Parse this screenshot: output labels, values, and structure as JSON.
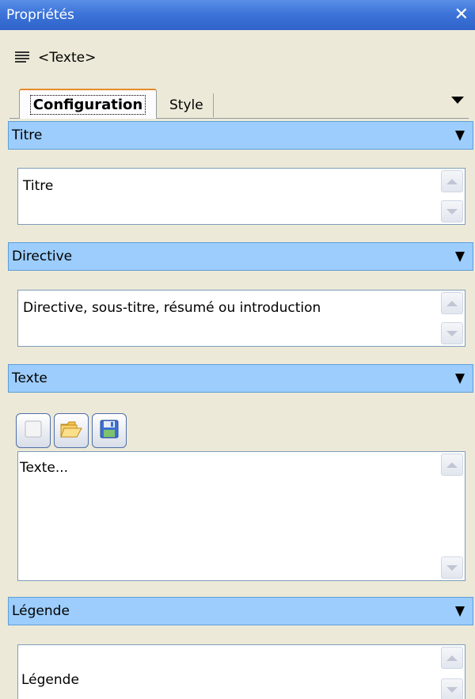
{
  "window": {
    "title": "Propriétés"
  },
  "node": {
    "label": "<Texte>",
    "icon": "text-lines-icon"
  },
  "tabs": [
    {
      "label": "Configuration",
      "active": true
    },
    {
      "label": "Style",
      "active": false
    }
  ],
  "sections": {
    "title": {
      "header": "Titre",
      "value": "Titre"
    },
    "directive": {
      "header": "Directive",
      "value": "Directive, sous-titre, résumé ou introduction"
    },
    "text": {
      "header": "Texte",
      "value": "Texte...",
      "toolbar": [
        "new-document-icon",
        "open-folder-icon",
        "save-icon"
      ]
    },
    "legend": {
      "header": "Légende",
      "value": "Légende"
    }
  },
  "colors": {
    "titlebar": "#3d74d9",
    "section_header": "#9ccdfc",
    "background": "#ece9d8",
    "active_tab_accent": "#e68b2c"
  }
}
